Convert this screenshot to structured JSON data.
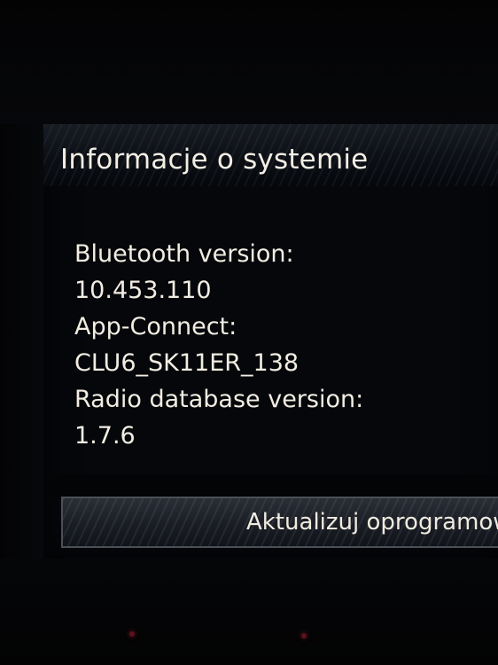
{
  "screen": {
    "title": "Informacje o systemie",
    "info": [
      {
        "text": "Bluetooth version:"
      },
      {
        "text": "10.453.110"
      },
      {
        "text": "App-Connect:"
      },
      {
        "text": "CLU6_SK11ER_138"
      },
      {
        "text": "Radio database version:"
      },
      {
        "text": "1.7.6"
      }
    ],
    "update_button_label": "Aktualizuj oprogramow"
  },
  "colors": {
    "text": "#f2ede2",
    "background": "#05070b",
    "button_border": "#4a4f58"
  }
}
